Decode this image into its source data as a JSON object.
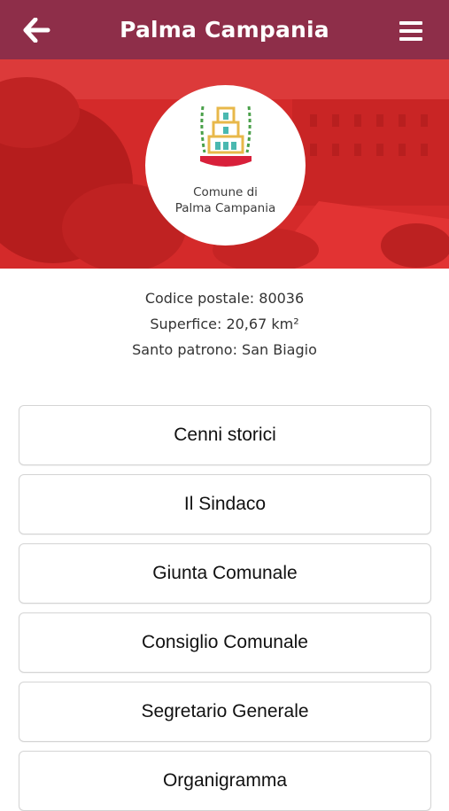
{
  "header": {
    "title": "Palma Campania"
  },
  "logo": {
    "line1": "Comune di",
    "line2": "Palma Campania"
  },
  "info": {
    "postal_code": "Codice postale: 80036",
    "area": "Superfice: 20,67 km²",
    "patron": "Santo patrono: San Biagio"
  },
  "menu_buttons": [
    {
      "label": "Cenni storici"
    },
    {
      "label": "Il Sindaco"
    },
    {
      "label": "Giunta Comunale"
    },
    {
      "label": "Consiglio Comunale"
    },
    {
      "label": "Segretario Generale"
    },
    {
      "label": "Organigramma"
    }
  ],
  "colors": {
    "header": "#8e2e49",
    "hero": "#d42a2a",
    "emblem_gold": "#e8b84a",
    "emblem_green": "#4aa04a",
    "emblem_red": "#d8203a",
    "emblem_teal": "#4ab8b0"
  }
}
